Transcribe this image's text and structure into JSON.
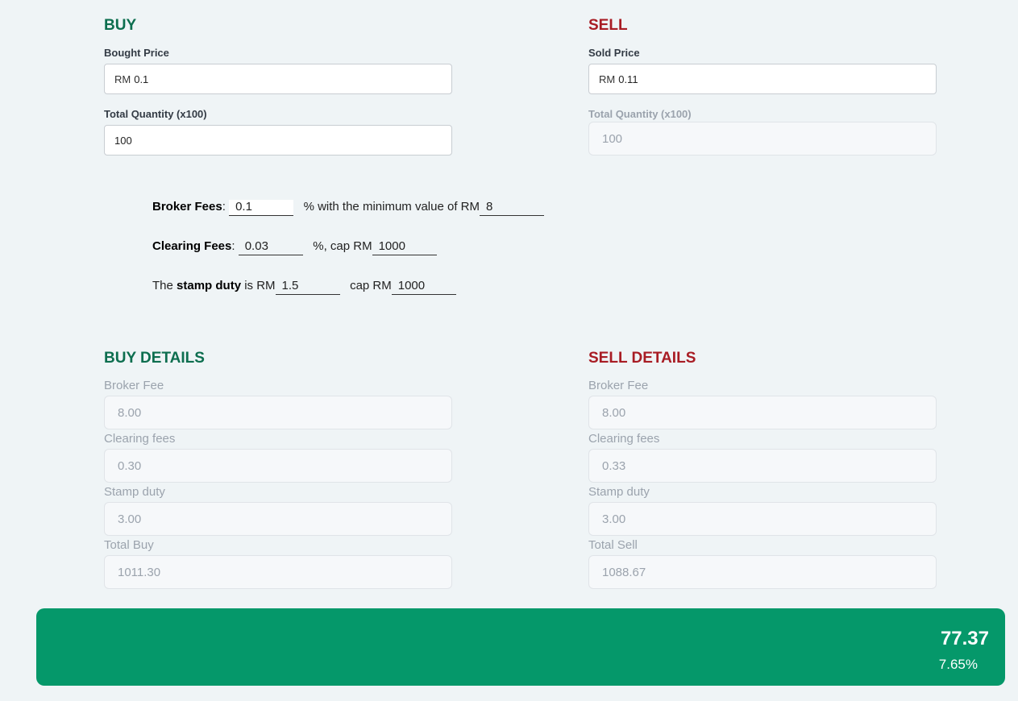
{
  "buy": {
    "title": "BUY",
    "price_label": "Bought Price",
    "price_prefix": "RM",
    "price_value": "0.1",
    "qty_label": "Total Quantity (x100)",
    "qty_value": "100"
  },
  "sell": {
    "title": "SELL",
    "price_label": "Sold Price",
    "price_prefix": "RM",
    "price_value": "0.11",
    "qty_label": "Total Quantity (x100)",
    "qty_value": "100"
  },
  "fees": {
    "broker_label": "Broker Fees",
    "broker_value": "0.1",
    "broker_text": "% with the minimum value of RM",
    "broker_min": "8",
    "clearing_label": "Clearing Fees",
    "clearing_value": "0.03",
    "clearing_text": "%, cap RM",
    "clearing_cap": "1000",
    "stamp_pre": "The",
    "stamp_label": "stamp duty",
    "stamp_is": "is RM",
    "stamp_value": "1.5",
    "stamp_cap_text": "cap RM",
    "stamp_cap": "1000"
  },
  "buy_details": {
    "title": "BUY DETAILS",
    "broker_fee_label": "Broker Fee",
    "broker_fee": "8.00",
    "clearing_label": "Clearing fees",
    "clearing": "0.30",
    "stamp_label": "Stamp duty",
    "stamp": "3.00",
    "total_label": "Total Buy",
    "total": "1011.30"
  },
  "sell_details": {
    "title": "SELL DETAILS",
    "broker_fee_label": "Broker Fee",
    "broker_fee": "8.00",
    "clearing_label": "Clearing fees",
    "clearing": "0.33",
    "stamp_label": "Stamp duty",
    "stamp": "3.00",
    "total_label": "Total Sell",
    "total": "1088.67"
  },
  "result": {
    "profit": "77.37",
    "percent": "7.65%",
    "color": "#05986a"
  },
  "colors": {
    "buy": "#0d6e4f",
    "sell": "#a81c24",
    "background": "#eff4f6"
  }
}
